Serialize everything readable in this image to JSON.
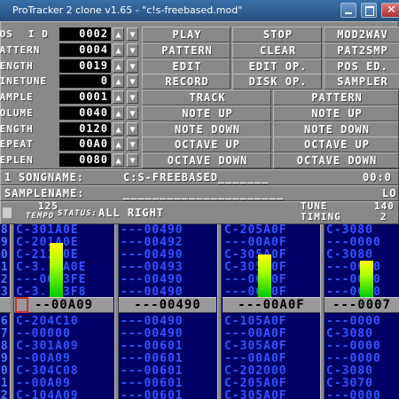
{
  "window": {
    "title": "ProTracker 2 clone v1.65 - \"c!s-freebased.mod\""
  },
  "left_panel": {
    "rows": [
      {
        "label": "POS",
        "id_label": "I D",
        "value": "0002"
      },
      {
        "label": "PATTERN",
        "value": "0004"
      },
      {
        "label": "LENGTH",
        "value": "0019"
      },
      {
        "label": "FINETUNE",
        "value": "0"
      },
      {
        "label": "SAMPLE",
        "value": "0001"
      },
      {
        "label": "VOLUME",
        "value": "0040"
      },
      {
        "label": "LENGTH",
        "value": "0120"
      },
      {
        "label": "REPEAT",
        "value": "00A0"
      },
      {
        "label": "REPLEN",
        "value": "0080"
      }
    ]
  },
  "right_buttons": {
    "rows": [
      [
        "PLAY",
        "STOP",
        "MOD2WAV"
      ],
      [
        "PATTERN",
        "CLEAR",
        "PAT2SMP"
      ],
      [
        "EDIT",
        "EDIT OP.",
        "POS ED."
      ],
      [
        "RECORD",
        "DISK OP.",
        "SAMPLER"
      ]
    ],
    "track_label": "TRACK",
    "pattern_label": "PATTERN",
    "updown": [
      [
        "NOTE UP",
        "NOTE UP"
      ],
      [
        "NOTE DOWN",
        "NOTE DOWN"
      ],
      [
        "OCTAVE UP",
        "OCTAVE UP"
      ],
      [
        "OCTAVE DOWN",
        "OCTAVE DOWN"
      ]
    ]
  },
  "song": {
    "songname_label": "SONGNAME:",
    "songname_value": "C:S-FREEBASED_______",
    "time": "00:0",
    "left_digit": "1",
    "samplename_label": "SAMPLENAME:",
    "samplename_value": "______________________",
    "lo_label": "LO"
  },
  "status": {
    "tempo_value": "125",
    "tempo_label": "TEMPO",
    "status_label": "STATUS:",
    "status_text": "ALL RIGHT",
    "tune_label": "TUNE",
    "timing_label": "TIMING",
    "tune_value": "140",
    "timing_value": "2"
  },
  "pattern": {
    "row_numbers": [
      "28",
      "29",
      "30",
      "31",
      "32",
      "33",
      "34",
      "35",
      "36",
      "37",
      "38",
      "39",
      "40",
      "41",
      "42"
    ],
    "channels": [
      {
        "rows_above": [
          "C-301A0E",
          "C-201A0E",
          "C-211A0E",
          "C-3..0A0E",
          "---0013FE",
          "C-3..03F8",
          "C-314A09"
        ],
        "current": "--00A09",
        "rows_below": [
          "C-204C10",
          "--00000",
          "C-301A09",
          "--00A09",
          "C-304C08",
          "--00A09",
          "C-104A09"
        ]
      },
      {
        "rows_above": [
          "---00490",
          "---00492",
          "---00490",
          "---00493",
          "---00490",
          "---00490",
          "---00490"
        ],
        "current": "---00490",
        "rows_below": [
          "---00490",
          "---00490",
          "---00601",
          "---00601",
          "---00601",
          "---00601",
          "---00601"
        ]
      },
      {
        "rows_above": [
          "C-205A0F",
          "---00A0F",
          "C-305A0F",
          "C-305A0F",
          "---00A0F",
          "---00A0F",
          "---00A0F"
        ],
        "current": "---00A0F",
        "rows_below": [
          "C-105A0F",
          "---00A0F",
          "C-305A0F",
          "---00A0F",
          "C-202000",
          "C-205A0F",
          "C-305A0F"
        ]
      },
      {
        "rows_above": [
          "C-3080",
          "---0000",
          "C-3080",
          "---0000",
          "---0000",
          "---0000",
          "---0000"
        ],
        "current": "---0007",
        "rows_below": [
          "---0000",
          "C-3080",
          "---0000",
          "---0000",
          "C-3080",
          "C-3070",
          "---0000"
        ]
      }
    ],
    "vu_levels": [
      0.87,
      0,
      0.68,
      0.58
    ]
  },
  "colors": {
    "panel": "#888888",
    "pattern_bg": "#000066",
    "pattern_text": "#3355ff",
    "cursor_bar": "#999999"
  }
}
